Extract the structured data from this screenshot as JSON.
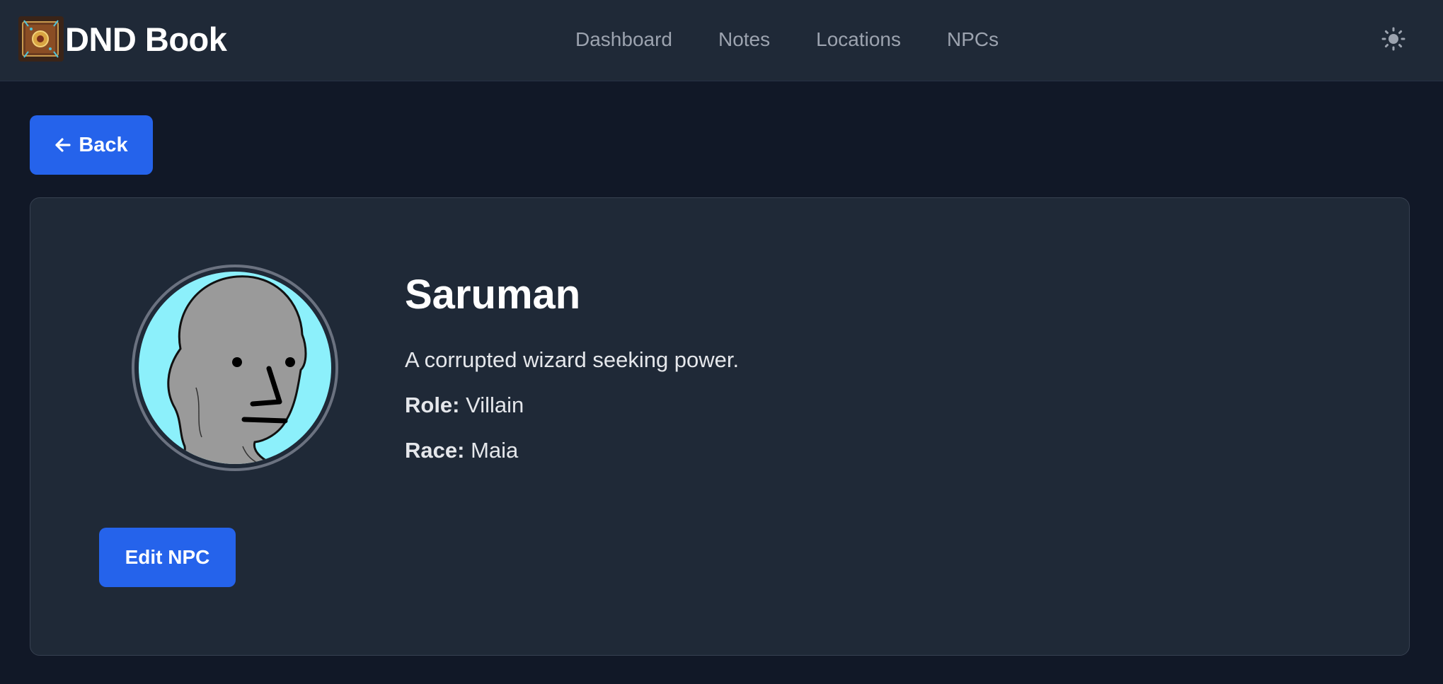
{
  "brand": {
    "title": "DND Book",
    "logo_icon": "spellbook-logo"
  },
  "nav": {
    "links": [
      "Dashboard",
      "Notes",
      "Locations",
      "NPCs"
    ],
    "theme_icon": "sun-icon"
  },
  "back_button": {
    "label": "Back",
    "icon": "arrow-left-icon"
  },
  "npc": {
    "name": "Saruman",
    "description": "A corrupted wizard seeking power.",
    "role_label": "Role:",
    "role": "Villain",
    "race_label": "Race:",
    "race": "Maia",
    "avatar_icon": "npc-wojak-avatar"
  },
  "edit_button": {
    "label": "Edit NPC"
  },
  "colors": {
    "page_bg": "#111827",
    "surface": "#1f2937",
    "accent": "#2563eb",
    "avatar_bg": "#8cf0fb"
  }
}
